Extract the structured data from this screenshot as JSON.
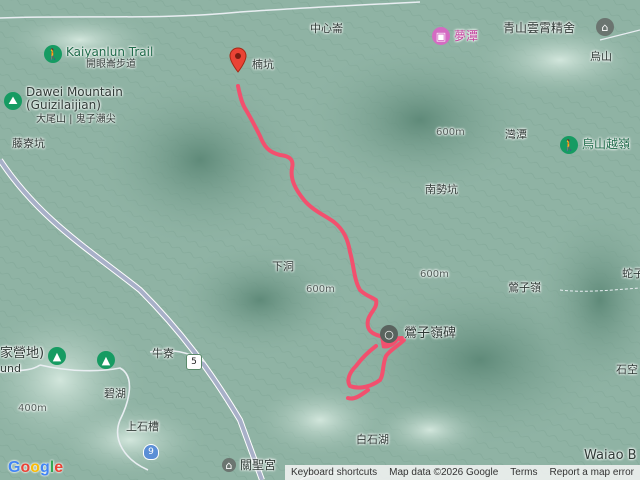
{
  "map": {
    "colors": {
      "terrain": "#8fb3a4",
      "ridge": "#6f9887",
      "valley": "#c4dbd0",
      "track": "#f24e6b",
      "road": "#9aa6b8",
      "expressway": "#aab2c6"
    },
    "labels": {
      "kaiyanlun_trail": "Kaiyanlun Trail",
      "kaiyanlun_zh": "開眼崙步道",
      "dawei_mountain": "Dawei Mountain",
      "guizilaijian": "(Guizilaijian)",
      "dawei_zh": "大尾山 | 鬼子瀨尖",
      "tengliaokeng": "藤寮坑",
      "zhongxinlun": "中心崙",
      "mengtan": "夢潭",
      "qingshan": "青山雲霄精舍",
      "wushan": "烏山",
      "wushanyue": "烏山越嶺",
      "wantan": "灣潭",
      "nanshikeng": "南勢坑",
      "xiadong": "下洞",
      "yingziling": "鶯子嶺",
      "yingziling_stele": "鶯子嶺碑",
      "shekong": "蛇子",
      "shikong": "石空",
      "waiao": "Waiao B",
      "niuliao": "牛寮",
      "bihu": "碧湖",
      "shangshicao": "上石槽",
      "baishihu": "白石湖",
      "guanshenggong": "關聖宮",
      "campsite": "家營地)",
      "und": "und",
      "start_label": "楠坑",
      "contour_400": "400m",
      "contour_600": "600m"
    },
    "shields": {
      "route5": "5",
      "route9": "9"
    },
    "icons": [
      "location-pin-icon",
      "hiking-icon",
      "camping-icon",
      "temple-icon",
      "summit-icon"
    ]
  },
  "footer": {
    "google": [
      "G",
      "o",
      "o",
      "g",
      "l",
      "e"
    ],
    "keyboard": "Keyboard shortcuts",
    "mapdata": "Map data ©2026 Google",
    "terms": "Terms",
    "report": "Report a map error"
  }
}
